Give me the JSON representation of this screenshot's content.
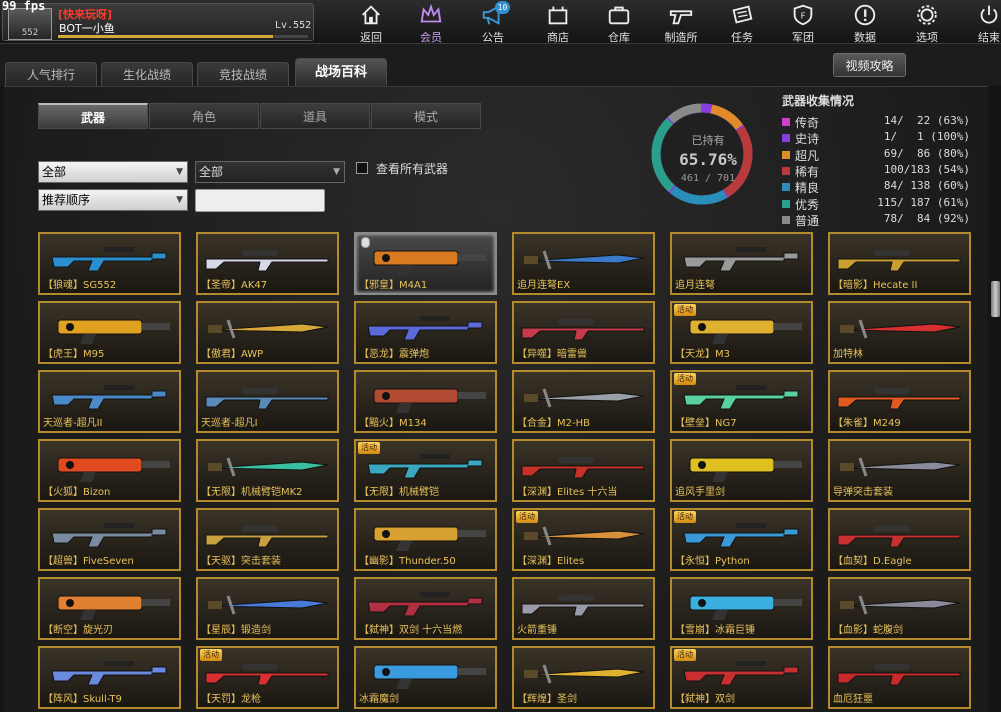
{
  "fps": "99 fps",
  "player": {
    "tag": "[快来玩呀]",
    "name": "BOT一小鱼",
    "level": "Lv.552",
    "avatar_text": "552",
    "xp_fraction": 0.86
  },
  "nav": [
    {
      "id": "back",
      "label": "返回",
      "icon": "home-icon"
    },
    {
      "id": "member",
      "label": "会员",
      "icon": "crown-icon",
      "active": true
    },
    {
      "id": "notice",
      "label": "公告",
      "icon": "megaphone-icon",
      "badge": "10"
    },
    {
      "id": "shop",
      "label": "商店",
      "icon": "shop-icon"
    },
    {
      "id": "warehouse",
      "label": "仓库",
      "icon": "briefcase-icon"
    },
    {
      "id": "craft",
      "label": "制造所",
      "icon": "gun-icon"
    },
    {
      "id": "mission",
      "label": "任务",
      "icon": "mission-icon"
    },
    {
      "id": "legion",
      "label": "军团",
      "icon": "shield-icon"
    },
    {
      "id": "data",
      "label": "数据",
      "icon": "info-icon"
    },
    {
      "id": "options",
      "label": "选项",
      "icon": "gear-icon"
    },
    {
      "id": "exit",
      "label": "结束",
      "icon": "power-icon"
    }
  ],
  "tabs": [
    {
      "label": "人气排行"
    },
    {
      "label": "生化战绩"
    },
    {
      "label": "竞技战绩"
    },
    {
      "label": "战场百科",
      "active": true
    }
  ],
  "video_button": "视频攻略",
  "subtabs": [
    {
      "label": "武器",
      "active": true
    },
    {
      "label": "角色"
    },
    {
      "label": "道具"
    },
    {
      "label": "模式"
    }
  ],
  "filters": {
    "filter1": "全部",
    "filter2": "全部",
    "sort": "推荐顺序",
    "search_value": "",
    "view_all_label": "查看所有武器"
  },
  "collection": {
    "title": "武器收集情况",
    "owned_label": "已持有",
    "percent": "65.76%",
    "count": "461 / 701",
    "owned": 461,
    "total": 701,
    "rows": [
      {
        "name": "传奇",
        "text": "14/  22 (63%)",
        "owned": 14,
        "total": 22,
        "color": "#d23ed2"
      },
      {
        "name": "史诗",
        "text": "1/   1 (100%)",
        "owned": 1,
        "total": 1,
        "color": "#8a3ee0"
      },
      {
        "name": "超凡",
        "text": "69/  86 (80%)",
        "owned": 69,
        "total": 86,
        "color": "#e08a2a"
      },
      {
        "name": "稀有",
        "text": "100/183 (54%)",
        "owned": 100,
        "total": 183,
        "color": "#b83a3a"
      },
      {
        "name": "精良",
        "text": "84/ 138 (60%)",
        "owned": 84,
        "total": 138,
        "color": "#2a8fb8"
      },
      {
        "name": "优秀",
        "text": "115/ 187 (61%)",
        "owned": 115,
        "total": 187,
        "color": "#2aa08a"
      },
      {
        "name": "普通",
        "text": "78/  84 (92%)",
        "owned": 78,
        "total": 84,
        "color": "#8a8a8a"
      }
    ]
  },
  "weapons": [
    {
      "name": "【狼魂】SG552",
      "palette": "#2a8fd0",
      "badge": ""
    },
    {
      "name": "【圣帝】AK47",
      "palette": "#d8d8e8",
      "badge": ""
    },
    {
      "name": "【邪皇】M4A1",
      "palette": "#d87a20",
      "badge": "",
      "selected": true
    },
    {
      "name": "追月连弩EX",
      "palette": "#3a7ac8",
      "badge": ""
    },
    {
      "name": "追月连弩",
      "palette": "#9a9a9a",
      "badge": ""
    },
    {
      "name": "【暗影】Hecate II",
      "palette": "#c8a030",
      "badge": ""
    },
    {
      "name": "【虎王】M95",
      "palette": "#e0a020",
      "badge": ""
    },
    {
      "name": "【傲君】AWP",
      "palette": "#d8a838",
      "badge": ""
    },
    {
      "name": "【恶龙】震弹炮",
      "palette": "#5a6ad8",
      "badge": ""
    },
    {
      "name": "【异噬】暗雷兽",
      "palette": "#c83a4a",
      "badge": ""
    },
    {
      "name": "【天龙】M3",
      "palette": "#e0b030",
      "badge": "活动"
    },
    {
      "name": "加特林",
      "palette": "#d83030",
      "badge": ""
    },
    {
      "name": "天巡者-超凡II",
      "palette": "#4a8ac8",
      "badge": ""
    },
    {
      "name": "天巡者-超凡I",
      "palette": "#5a8ab8",
      "badge": ""
    },
    {
      "name": "【黯火】M134",
      "palette": "#b04a30",
      "badge": ""
    },
    {
      "name": "【合金】M2-HB",
      "palette": "#9aa0a8",
      "badge": ""
    },
    {
      "name": "【壁垒】NG7",
      "palette": "#5ad0a0",
      "badge": "活动"
    },
    {
      "name": "【朱雀】M249",
      "palette": "#e05a20",
      "badge": ""
    },
    {
      "name": "【火狐】Bizon",
      "palette": "#e04a20",
      "badge": ""
    },
    {
      "name": "【无限】机械臂铠MK2",
      "palette": "#3ac0a0",
      "badge": ""
    },
    {
      "name": "【无限】机械臂铠",
      "palette": "#3aa8c0",
      "badge": "活动"
    },
    {
      "name": "【深渊】Elites 十六当",
      "palette": "#c8302a",
      "badge": ""
    },
    {
      "name": "追风手里剑",
      "palette": "#e0c020",
      "badge": ""
    },
    {
      "name": "导弹突击套装",
      "palette": "#8a8a9a",
      "badge": ""
    },
    {
      "name": "【超兽】FiveSeven",
      "palette": "#7a8aa0",
      "badge": ""
    },
    {
      "name": "【天驱】突击套装",
      "palette": "#c8a040",
      "badge": ""
    },
    {
      "name": "【幽影】Thunder.50",
      "palette": "#d8a030",
      "badge": ""
    },
    {
      "name": "【深渊】Elites",
      "palette": "#d8903a",
      "badge": "活动"
    },
    {
      "name": "【永恒】Python",
      "palette": "#3a9ad8",
      "badge": "活动"
    },
    {
      "name": "【血契】D.Eagle",
      "palette": "#c83030",
      "badge": ""
    },
    {
      "name": "【断空】旋光刃",
      "palette": "#e08030",
      "badge": ""
    },
    {
      "name": "【星辰】锻造剑",
      "palette": "#4a7ad8",
      "badge": ""
    },
    {
      "name": "【弑神】双剑 十六当燃",
      "palette": "#b03040",
      "badge": ""
    },
    {
      "name": "火箭重锤",
      "palette": "#9a9aa8",
      "badge": ""
    },
    {
      "name": "【雪崩】冰霜巨锤",
      "palette": "#3ab0e0",
      "badge": ""
    },
    {
      "name": "【血影】蛇腹剑",
      "palette": "#8a8a9a",
      "badge": ""
    },
    {
      "name": "【阵风】Skull-T9",
      "palette": "#6a8ae0",
      "badge": ""
    },
    {
      "name": "【天罚】龙枪",
      "palette": "#d83030",
      "badge": "活动"
    },
    {
      "name": "冰霜魔剑",
      "palette": "#3a9ae0",
      "badge": ""
    },
    {
      "name": "【辉煌】圣剑",
      "palette": "#e0b030",
      "badge": ""
    },
    {
      "name": "【弑神】双剑",
      "palette": "#c83030",
      "badge": "活动"
    },
    {
      "name": "血厄狂噩",
      "palette": "#c82a2a",
      "badge": ""
    }
  ]
}
